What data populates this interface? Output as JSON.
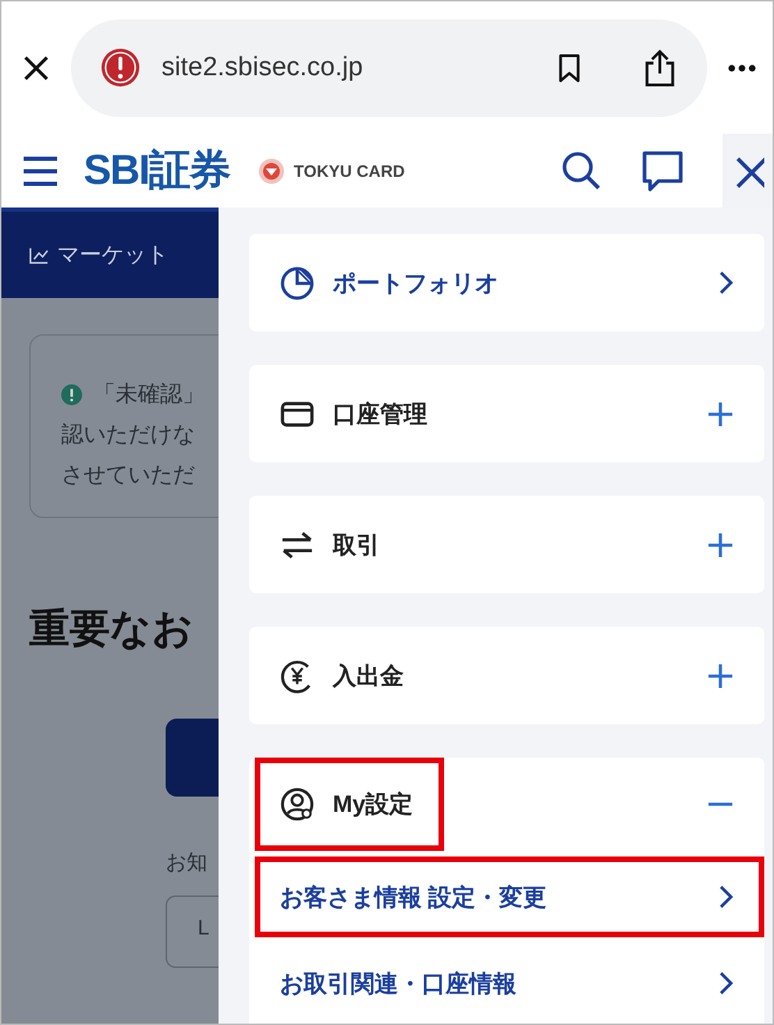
{
  "browser": {
    "url": "site2.sbisec.co.jp"
  },
  "header": {
    "logo": "SBI証券",
    "partner": "TOKYU CARD"
  },
  "background_page": {
    "tab": "マーケット",
    "notice_lines": [
      "「未確認」",
      "認いただけな",
      "させていただ"
    ],
    "heading": "重要なお",
    "caption": "お知",
    "box_text": "L"
  },
  "menu": [
    {
      "label": "ポートフォリオ",
      "kind": "link",
      "highlighted": false
    },
    {
      "label": "口座管理",
      "kind": "group",
      "expanded": false,
      "highlighted": false
    },
    {
      "label": "取引",
      "kind": "group",
      "expanded": false,
      "highlighted": false
    },
    {
      "label": "入出金",
      "kind": "group",
      "expanded": false,
      "highlighted": false
    },
    {
      "label": "My設定",
      "kind": "group",
      "expanded": true,
      "highlighted": true,
      "children": [
        {
          "label": "お客さま情報 設定・変更",
          "highlighted": true
        },
        {
          "label": "お取引関連・口座情報",
          "highlighted": false
        }
      ]
    }
  ]
}
